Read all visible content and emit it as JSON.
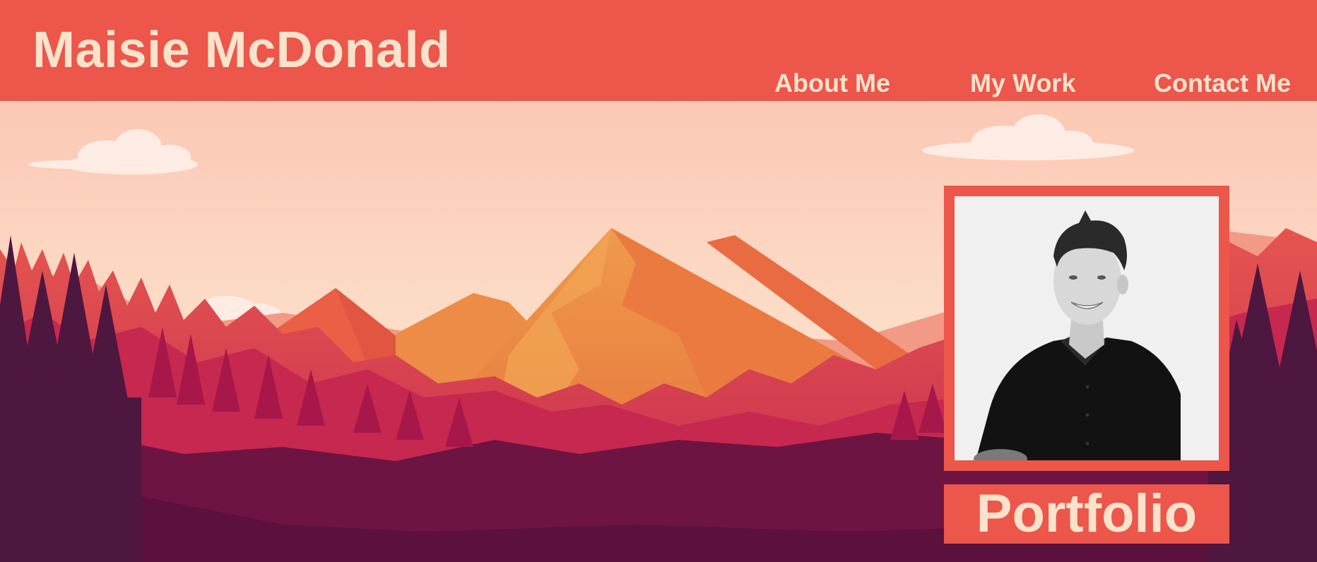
{
  "site": {
    "title": "Maisie McDonald"
  },
  "nav": {
    "items": [
      "About Me",
      "My Work",
      "Contact Me"
    ]
  },
  "hero": {
    "badge_label": "Portfolio",
    "photo_icon": "portrait-photo"
  },
  "colors": {
    "header": "#ec564b",
    "header_text": "#fbe2cb",
    "sky": "#fbd7c4",
    "mountain": "#eb8444",
    "forest": "#c9234f",
    "foreground": "#6e1443"
  }
}
